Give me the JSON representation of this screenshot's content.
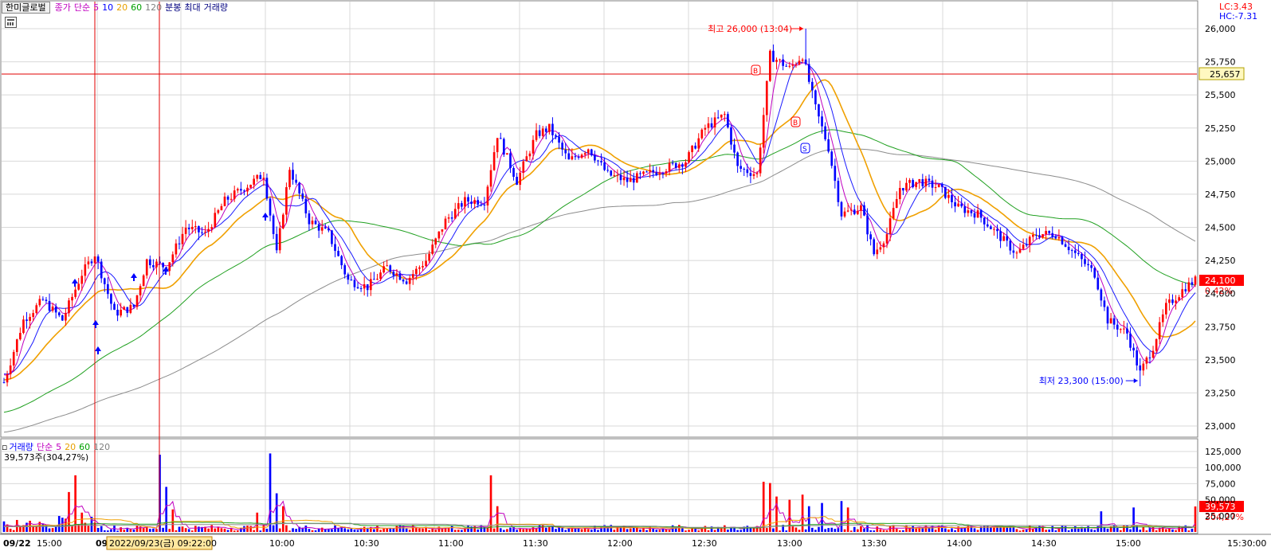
{
  "legend_price": {
    "name": "한미글로벌",
    "items": [
      {
        "label": "종가",
        "color": "#c000c0"
      },
      {
        "label": "단순",
        "color": "#c000c0"
      },
      {
        "label": "5",
        "color": "#c000c0"
      },
      {
        "label": "10",
        "color": "#0000ff"
      },
      {
        "label": "20",
        "color": "#e8a000"
      },
      {
        "label": "60",
        "color": "#00a000"
      },
      {
        "label": "120",
        "color": "#808080"
      },
      {
        "label": "분봉",
        "color": "#000080"
      },
      {
        "label": "최대",
        "color": "#000080"
      },
      {
        "label": "거래량",
        "color": "#000080"
      }
    ]
  },
  "legend_volume": {
    "items": [
      {
        "label": "거래량",
        "color": "#0000ff"
      },
      {
        "label": "단순",
        "color": "#c000c0"
      },
      {
        "label": "5",
        "color": "#c000c0"
      },
      {
        "label": "20",
        "color": "#e8a000"
      },
      {
        "label": "60",
        "color": "#00a000"
      },
      {
        "label": "120",
        "color": "#808080"
      }
    ],
    "current": "39,573주(304,27%)"
  },
  "lc_label": "LC:3.43",
  "hc_label": "HC:-7.31",
  "colors": {
    "up": "#ff0000",
    "down": "#0000ff",
    "ma5": "#c000c0",
    "ma10": "#1a1aff",
    "ma20": "#f0a000",
    "ma60": "#20a020",
    "ma120": "#8c8c8c",
    "grid": "#d8d8d8",
    "crosshair": "#e00000"
  },
  "chart_data": {
    "type": "candlestick",
    "title": "한미글로벌",
    "period": "분봉",
    "y_ticks": [
      "26,000",
      "25,750",
      "25,500",
      "25,250",
      "25,000",
      "24,750",
      "24,500",
      "24,250",
      "24,000",
      "23,750",
      "23,500",
      "23,250",
      "23,000"
    ],
    "y_tick_values": [
      26000,
      25750,
      25500,
      25250,
      25000,
      24750,
      24500,
      24250,
      24000,
      23750,
      23500,
      23250,
      23000
    ],
    "ylim": [
      22900,
      26150
    ],
    "x_ticks": [
      "09/22",
      "15:00",
      "09",
      "10:00",
      "10:30",
      "11:00",
      "11:30",
      "12:00",
      "12:30",
      "13:00",
      "13:30",
      "14:00",
      "14:30",
      "15:00",
      "15:30:00"
    ],
    "high": {
      "label": "최고 26,000 (13:04)",
      "value": 26000
    },
    "low": {
      "label": "최저 23,300 (15:00)",
      "value": 23300
    },
    "horizontal_line": {
      "label": "25,657",
      "value": 25657
    },
    "last_price": {
      "label": "24,100",
      "value": 24100
    },
    "change_pct": "0.42%",
    "crosshair_time": "2022/09/23(금) 09:22:00",
    "anchors": [
      {
        "t": 0,
        "p": 23330
      },
      {
        "t": 6,
        "p": 23800
      },
      {
        "t": 12,
        "p": 23950
      },
      {
        "t": 18,
        "p": 23800
      },
      {
        "t": 24,
        "p": 24150
      },
      {
        "t": 28,
        "p": 24300
      },
      {
        "t": 34,
        "p": 23850
      },
      {
        "t": 40,
        "p": 23900
      },
      {
        "t": 44,
        "p": 24250
      },
      {
        "t": 50,
        "p": 24200
      },
      {
        "t": 56,
        "p": 24500
      },
      {
        "t": 62,
        "p": 24450
      },
      {
        "t": 68,
        "p": 24700
      },
      {
        "t": 74,
        "p": 24800
      },
      {
        "t": 80,
        "p": 24900
      },
      {
        "t": 84,
        "p": 24300
      },
      {
        "t": 88,
        "p": 24950
      },
      {
        "t": 94,
        "p": 24550
      },
      {
        "t": 100,
        "p": 24450
      },
      {
        "t": 106,
        "p": 24100
      },
      {
        "t": 112,
        "p": 24050
      },
      {
        "t": 118,
        "p": 24200
      },
      {
        "t": 124,
        "p": 24100
      },
      {
        "t": 130,
        "p": 24250
      },
      {
        "t": 136,
        "p": 24550
      },
      {
        "t": 142,
        "p": 24700
      },
      {
        "t": 148,
        "p": 24700
      },
      {
        "t": 152,
        "p": 25200
      },
      {
        "t": 158,
        "p": 24850
      },
      {
        "t": 164,
        "p": 25200
      },
      {
        "t": 168,
        "p": 25250
      },
      {
        "t": 174,
        "p": 25000
      },
      {
        "t": 180,
        "p": 25100
      },
      {
        "t": 186,
        "p": 24900
      },
      {
        "t": 192,
        "p": 24850
      },
      {
        "t": 198,
        "p": 24900
      },
      {
        "t": 204,
        "p": 24950
      },
      {
        "t": 210,
        "p": 25000
      },
      {
        "t": 216,
        "p": 25250
      },
      {
        "t": 222,
        "p": 25350
      },
      {
        "t": 226,
        "p": 24950
      },
      {
        "t": 232,
        "p": 24900
      },
      {
        "t": 236,
        "p": 25800
      },
      {
        "t": 242,
        "p": 25700
      },
      {
        "t": 246,
        "p": 25800
      },
      {
        "t": 250,
        "p": 25400
      },
      {
        "t": 254,
        "p": 25100
      },
      {
        "t": 258,
        "p": 24600
      },
      {
        "t": 264,
        "p": 24650
      },
      {
        "t": 268,
        "p": 24300
      },
      {
        "t": 272,
        "p": 24450
      },
      {
        "t": 276,
        "p": 24800
      },
      {
        "t": 282,
        "p": 24850
      },
      {
        "t": 288,
        "p": 24800
      },
      {
        "t": 294,
        "p": 24650
      },
      {
        "t": 300,
        "p": 24600
      },
      {
        "t": 306,
        "p": 24450
      },
      {
        "t": 312,
        "p": 24300
      },
      {
        "t": 318,
        "p": 24450
      },
      {
        "t": 324,
        "p": 24450
      },
      {
        "t": 330,
        "p": 24300
      },
      {
        "t": 336,
        "p": 24150
      },
      {
        "t": 340,
        "p": 23800
      },
      {
        "t": 346,
        "p": 23700
      },
      {
        "t": 350,
        "p": 23400
      },
      {
        "t": 354,
        "p": 23600
      },
      {
        "t": 358,
        "p": 23900
      },
      {
        "t": 364,
        "p": 24050
      },
      {
        "t": 367,
        "p": 24100
      }
    ],
    "volume": {
      "y_ticks": [
        "125,000",
        "100,000",
        "75,000",
        "50,000",
        "25,000"
      ],
      "y_tick_values": [
        125000,
        100000,
        75000,
        50000,
        25000
      ],
      "ylim": [
        0,
        135000
      ],
      "current_label": "39,573",
      "current_pct": "304,27%",
      "spikes": [
        {
          "t": 20,
          "v": 62000
        },
        {
          "t": 22,
          "v": 88000
        },
        {
          "t": 24,
          "v": 30000
        },
        {
          "t": 48,
          "v": 120000
        },
        {
          "t": 50,
          "v": 70000
        },
        {
          "t": 52,
          "v": 35000
        },
        {
          "t": 78,
          "v": 30000
        },
        {
          "t": 82,
          "v": 122000
        },
        {
          "t": 84,
          "v": 60000
        },
        {
          "t": 86,
          "v": 40000
        },
        {
          "t": 150,
          "v": 88000
        },
        {
          "t": 152,
          "v": 40000
        },
        {
          "t": 234,
          "v": 78000
        },
        {
          "t": 236,
          "v": 76000
        },
        {
          "t": 238,
          "v": 55000
        },
        {
          "t": 242,
          "v": 50000
        },
        {
          "t": 246,
          "v": 58000
        },
        {
          "t": 248,
          "v": 40000
        },
        {
          "t": 252,
          "v": 45000
        },
        {
          "t": 258,
          "v": 48000
        },
        {
          "t": 260,
          "v": 38000
        },
        {
          "t": 338,
          "v": 32000
        },
        {
          "t": 348,
          "v": 38000
        },
        {
          "t": 367,
          "v": 39573
        }
      ]
    }
  }
}
